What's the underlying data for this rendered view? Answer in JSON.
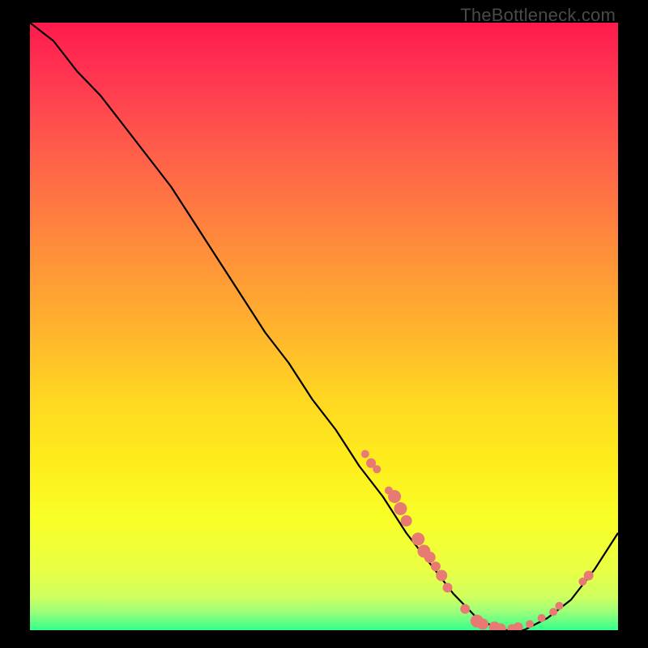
{
  "watermark": "TheBottleneck.com",
  "colors": {
    "dot": "#e87a74",
    "curve": "#000000",
    "gradient_top": "#ff1a4d",
    "gradient_bottom": "#33ff8a"
  },
  "chart_data": {
    "type": "line",
    "title": "",
    "xlabel": "",
    "ylabel": "",
    "xlim": [
      0,
      100
    ],
    "ylim": [
      0,
      100
    ],
    "x": [
      0,
      4,
      8,
      12,
      16,
      20,
      24,
      28,
      32,
      36,
      40,
      44,
      48,
      52,
      56,
      60,
      64,
      68,
      72,
      76,
      80,
      84,
      88,
      92,
      96,
      100
    ],
    "values": [
      102,
      97,
      92,
      88,
      83,
      78,
      73,
      67,
      61,
      55,
      49,
      44,
      38,
      33,
      27,
      22,
      16,
      11,
      6,
      2,
      0,
      0,
      2,
      5,
      10,
      16
    ],
    "note": "values are estimated relative bottleneck % (height above baseline); curve exits the top-left of the plot",
    "dots": [
      {
        "x": 57,
        "y": 29,
        "r": 5
      },
      {
        "x": 58,
        "y": 27.5,
        "r": 6
      },
      {
        "x": 59,
        "y": 26.5,
        "r": 5
      },
      {
        "x": 61,
        "y": 23,
        "r": 5
      },
      {
        "x": 62,
        "y": 22,
        "r": 8
      },
      {
        "x": 63,
        "y": 20,
        "r": 8
      },
      {
        "x": 64,
        "y": 18,
        "r": 7
      },
      {
        "x": 66,
        "y": 15,
        "r": 8
      },
      {
        "x": 67,
        "y": 13,
        "r": 8
      },
      {
        "x": 68,
        "y": 12,
        "r": 7
      },
      {
        "x": 69,
        "y": 10.5,
        "r": 6
      },
      {
        "x": 70,
        "y": 9,
        "r": 7
      },
      {
        "x": 71,
        "y": 7,
        "r": 6
      },
      {
        "x": 74,
        "y": 3.5,
        "r": 6
      },
      {
        "x": 76,
        "y": 1.5,
        "r": 8
      },
      {
        "x": 77,
        "y": 1,
        "r": 7
      },
      {
        "x": 79,
        "y": 0.5,
        "r": 7
      },
      {
        "x": 80,
        "y": 0.2,
        "r": 7
      },
      {
        "x": 82,
        "y": 0.2,
        "r": 6
      },
      {
        "x": 83,
        "y": 0.5,
        "r": 6
      },
      {
        "x": 85,
        "y": 1,
        "r": 5
      },
      {
        "x": 87,
        "y": 2,
        "r": 5
      },
      {
        "x": 89,
        "y": 3,
        "r": 5
      },
      {
        "x": 90,
        "y": 4,
        "r": 5
      },
      {
        "x": 94,
        "y": 8,
        "r": 5
      },
      {
        "x": 95,
        "y": 9,
        "r": 6
      }
    ]
  }
}
